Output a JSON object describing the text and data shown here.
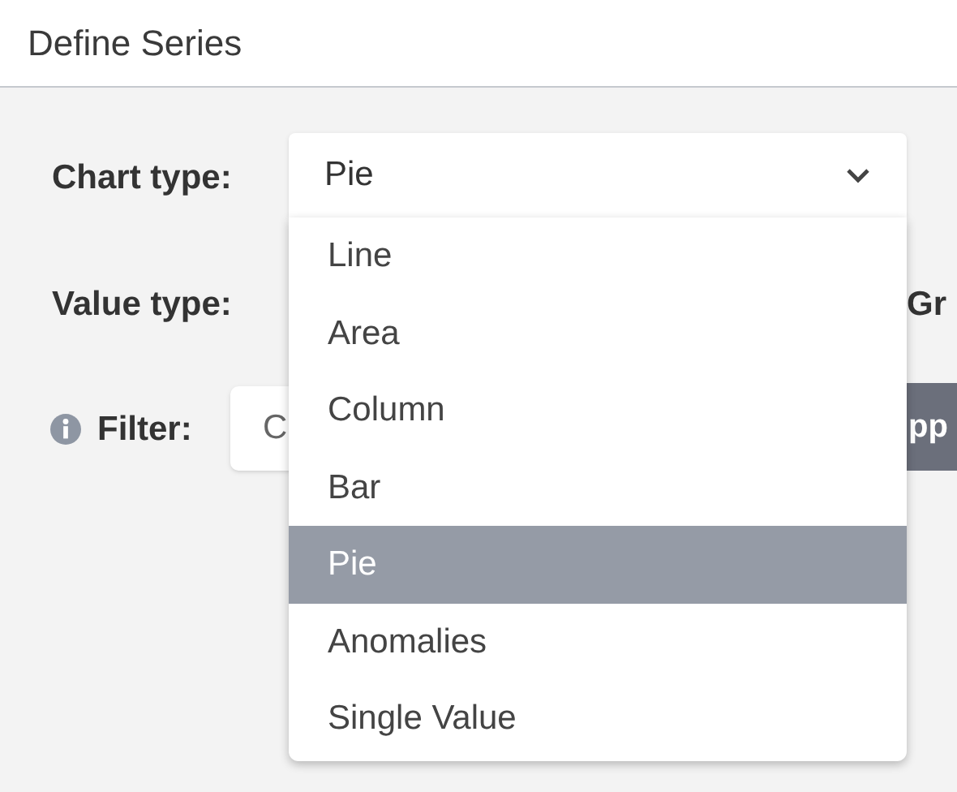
{
  "header": {
    "title": "Define Series"
  },
  "chart_type": {
    "label": "Chart type:",
    "value": "Pie",
    "expanded": true,
    "options": [
      {
        "label": "Line",
        "selected": false
      },
      {
        "label": "Area",
        "selected": false
      },
      {
        "label": "Column",
        "selected": false
      },
      {
        "label": "Bar",
        "selected": false
      },
      {
        "label": "Pie",
        "selected": true
      },
      {
        "label": "Anomalies",
        "selected": false
      },
      {
        "label": "Single Value",
        "selected": false
      }
    ]
  },
  "value_type": {
    "label": "Value type:",
    "next_label": "Gr"
  },
  "filter": {
    "label": "Filter:",
    "value": "C",
    "button": "pp"
  }
}
